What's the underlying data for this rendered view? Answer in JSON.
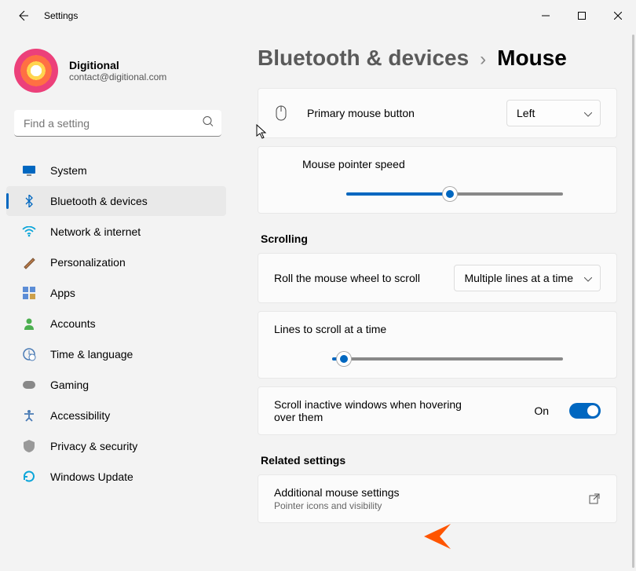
{
  "window": {
    "title": "Settings"
  },
  "profile": {
    "name": "Digitional",
    "email": "contact@digitional.com"
  },
  "search": {
    "placeholder": "Find a setting"
  },
  "nav": {
    "items": [
      {
        "label": "System"
      },
      {
        "label": "Bluetooth & devices"
      },
      {
        "label": "Network & internet"
      },
      {
        "label": "Personalization"
      },
      {
        "label": "Apps"
      },
      {
        "label": "Accounts"
      },
      {
        "label": "Time & language"
      },
      {
        "label": "Gaming"
      },
      {
        "label": "Accessibility"
      },
      {
        "label": "Privacy & security"
      },
      {
        "label": "Windows Update"
      }
    ]
  },
  "breadcrumb": {
    "parent": "Bluetooth & devices",
    "current": "Mouse"
  },
  "primaryButton": {
    "label": "Primary mouse button",
    "value": "Left"
  },
  "pointerSpeed": {
    "label": "Mouse pointer speed",
    "percent": 48
  },
  "scrolling": {
    "heading": "Scrolling",
    "wheel": {
      "label": "Roll the mouse wheel to scroll",
      "value": "Multiple lines at a time"
    },
    "lines": {
      "label": "Lines to scroll at a time",
      "percent": 5
    },
    "inactive": {
      "label": "Scroll inactive windows when hovering over them",
      "stateLabel": "On",
      "on": true
    }
  },
  "related": {
    "heading": "Related settings",
    "additional": {
      "title": "Additional mouse settings",
      "subtitle": "Pointer icons and visibility"
    }
  }
}
